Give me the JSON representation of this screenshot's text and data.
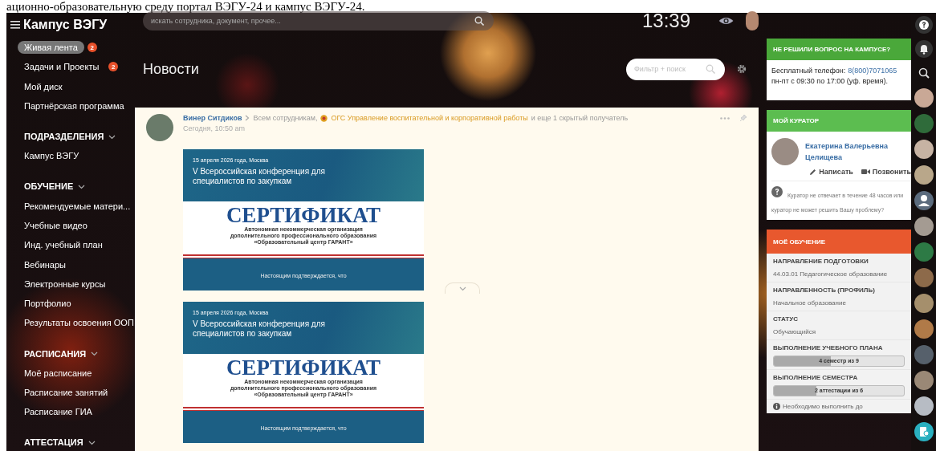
{
  "document_caption": "ационно-образовательную среду портал ВЭГУ-24 и кампус ВЭГУ-24.",
  "header": {
    "logo": "Кампус ВЭГУ",
    "search": {
      "placeholder": "искать сотрудника, документ, прочее..."
    },
    "clock": "13:39"
  },
  "sidebar": {
    "items": [
      {
        "label": "Живая лента",
        "selected": true,
        "badge": "2"
      },
      {
        "label": "Задачи и Проекты",
        "selected": false,
        "badge": "2"
      },
      {
        "label": "Мой диск",
        "selected": false
      },
      {
        "label": "Партнёрская программа",
        "selected": false
      }
    ],
    "sections": [
      {
        "title": "ПОДРАЗДЕЛЕНИЯ",
        "items": [
          "Кампус ВЭГУ"
        ]
      },
      {
        "title": "ОБУЧЕНИЕ",
        "items": [
          "Рекомендуемые матери...",
          "Учебные видео",
          "Инд. учебный план",
          "Вебинары",
          "Электронные курсы",
          "Портфолио",
          "Результаты освоения ООП"
        ]
      },
      {
        "title": "РАСПИСАНИЯ",
        "items": [
          "Моё расписание",
          "Расписание занятий",
          "Расписание ГИА"
        ]
      },
      {
        "title": "АТТЕСТАЦИЯ"
      }
    ]
  },
  "page": {
    "title": "Новости",
    "filter": {
      "placeholder": "Фильтр + поиск"
    }
  },
  "post": {
    "author": "Винер Ситдиков",
    "recipients": "Всем сотрудникам,",
    "group": "ОГС Управление воспитательной и корпоративной работы",
    "hidden_recipients": "и еще 1 скрытый получатель",
    "time": "Сегодня, 10:50 am",
    "attachments": [
      {
        "date": "15 апреля 2026 года, Москва",
        "event": "V Всероссийская конференция для специалистов по закупкам",
        "heading": "СЕРТИФИКАТ",
        "organization": [
          "Автономная некоммерческая организация",
          "дополнительного профессионального образования",
          "«Образовательный центр ГАРАНТ»"
        ],
        "footer": "Настоящим подтверждается, что"
      },
      {
        "date": "15 апреля 2026 года, Москва",
        "event": "V Всероссийская конференция для специалистов по закупкам",
        "heading": "СЕРТИФИКАТ",
        "organization": [
          "Автономная некоммерческая организация",
          "дополнительного профессионального образования",
          "«Образовательный центр ГАРАНТ»"
        ],
        "footer": "Настоящим подтверждается, что"
      }
    ]
  },
  "help_panel": {
    "title": "НЕ РЕШИЛИ ВОПРОС НА КАМПУСЕ?",
    "phone_label": "Бесплатный телефон:",
    "phone": "8(800)7071065",
    "hours": "пн-пт с 09:30 по 17:00 (уф. время)."
  },
  "curator_panel": {
    "title": "МОЙ КУРАТОР",
    "name": "Екатерина Валерьевна Целищева",
    "write": "Написать",
    "call": "Позвонить",
    "note": "Куратор не отвечает в течение 48 часов или куратор не может решить Вашу проблему?"
  },
  "study_panel": {
    "title": "МОЁ ОБУЧЕНИЕ",
    "fields": [
      {
        "kind": "text",
        "label": "НАПРАВЛЕНИЕ ПОДГОТОВКИ",
        "value": "44.03.01 Педагогическое образование"
      },
      {
        "kind": "text",
        "label": "НАПРАВЛЕННОСТЬ (ПРОФИЛЬ)",
        "value": "Начальное образование"
      },
      {
        "kind": "text",
        "label": "СТАТУС",
        "value": "Обучающийся"
      },
      {
        "kind": "progress",
        "label": "ВЫПОЛНЕНИЕ УЧЕБНОГО ПЛАНА",
        "value": "4 семестр из 9",
        "level": 0.44
      },
      {
        "kind": "progress",
        "label": "ВЫПОЛНЕНИЕ СЕМЕСТРА",
        "value": "2 аттестации из 6",
        "level": 0.33
      }
    ],
    "note": "Необходимо выполнить до"
  },
  "rail": {
    "avatars": [
      {
        "kind": "photo"
      },
      {
        "kind": "photo"
      },
      {
        "kind": "photo"
      },
      {
        "kind": "photo"
      },
      {
        "kind": "silhouette"
      },
      {
        "kind": "photo"
      },
      {
        "kind": "photo"
      },
      {
        "kind": "photo"
      },
      {
        "kind": "photo"
      },
      {
        "kind": "photo"
      },
      {
        "kind": "photo"
      },
      {
        "kind": "photo"
      },
      {
        "kind": "photo"
      }
    ]
  }
}
